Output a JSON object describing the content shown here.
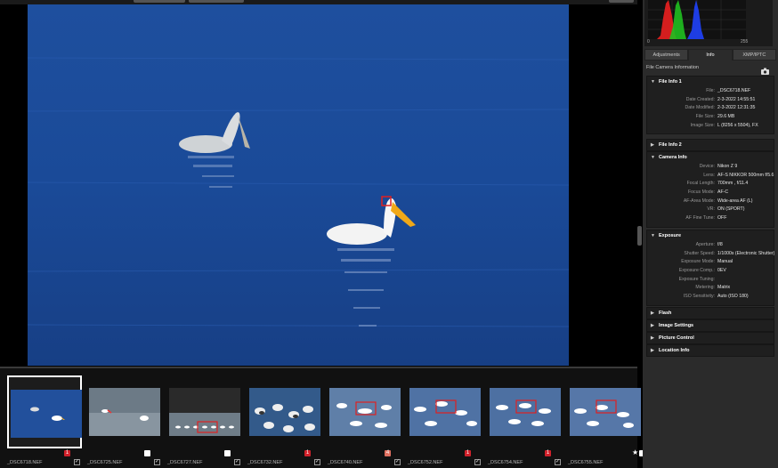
{
  "histogram": {
    "min_label": "0",
    "max_label": "255"
  },
  "tabs": [
    {
      "label": "Adjustments",
      "active": false
    },
    {
      "label": "Info",
      "active": true
    },
    {
      "label": "XMP/IPTC",
      "active": false
    }
  ],
  "breadcrumb": "File  Camera Information",
  "sections": {
    "file_info_1": {
      "title": "File Info 1",
      "rows": [
        {
          "k": "File:",
          "v": "_DSC6718.NEF"
        },
        {
          "k": "Date Created:",
          "v": "2-3-2022 14:55:51"
        },
        {
          "k": "Date Modified:",
          "v": "2-3-2022 12:31:35"
        },
        {
          "k": "File Size:",
          "v": "29.6 MB"
        },
        {
          "k": "Image Size:",
          "v": "L (8256 x 5504), FX"
        }
      ]
    },
    "file_info_2": {
      "title": "File Info 2"
    },
    "camera_info": {
      "title": "Camera Info",
      "rows": [
        {
          "k": "Device:",
          "v": "Nikon Z 9"
        },
        {
          "k": "Lens:",
          "v": "AF-S NIKKOR 500mm f/5.6"
        },
        {
          "k": "Focal Length:",
          "v": "700mm , f/11.4"
        },
        {
          "k": "Focus Mode:",
          "v": "AF-C"
        },
        {
          "k": "AF-Area Mode:",
          "v": "Wide-area AF (L)"
        },
        {
          "k": "VR:",
          "v": "ON (SPORT)"
        },
        {
          "k": "AF Fine Tune:",
          "v": "OFF"
        }
      ]
    },
    "exposure": {
      "title": "Exposure",
      "rows": [
        {
          "k": "Aperture:",
          "v": "f/8"
        },
        {
          "k": "Shutter Speed:",
          "v": "1/1000s (Electronic Shutter)"
        },
        {
          "k": "Exposure Mode:",
          "v": "Manual"
        },
        {
          "k": "Exposure Comp.:",
          "v": "0EV"
        },
        {
          "k": "Exposure Tuning:",
          "v": ""
        },
        {
          "k": "Metering:",
          "v": "Matrix"
        },
        {
          "k": "ISO Sensitivity:",
          "v": "Auto (ISO 180)"
        }
      ]
    },
    "flash": {
      "title": "Flash"
    },
    "image_settings": {
      "title": "Image Settings"
    },
    "picture_control": {
      "title": "Picture Control"
    },
    "location_info": {
      "title": "Location Info"
    }
  },
  "thumbnails": [
    {
      "name": "_DSC6718.NEF",
      "label_color": "#d0202a",
      "label_text": "1",
      "checked": true,
      "selected": true
    },
    {
      "name": "_DSC6725.NEF",
      "label_color": "#ffffff",
      "label_text": "",
      "checked": true,
      "selected": false
    },
    {
      "name": "_DSC6727.NEF",
      "label_color": "#ffffff",
      "label_text": "",
      "checked": true,
      "selected": false
    },
    {
      "name": "_DSC6732.NEF",
      "label_color": "#d0202a",
      "label_text": "1",
      "checked": true,
      "selected": false
    },
    {
      "name": "_DSC6740.NEF",
      "label_color": "#e07060",
      "label_text": "4",
      "checked": true,
      "selected": false
    },
    {
      "name": "_DSC6752.NEF",
      "label_color": "#d0202a",
      "label_text": "1",
      "checked": true,
      "selected": false
    },
    {
      "name": "_DSC6754.NEF",
      "label_color": "#d0202a",
      "label_text": "1",
      "checked": true,
      "selected": false
    },
    {
      "name": "_DSC6755.NEF",
      "label_color": "#ffffff",
      "label_text": "",
      "checked": false,
      "selected": false,
      "star": "★"
    }
  ]
}
